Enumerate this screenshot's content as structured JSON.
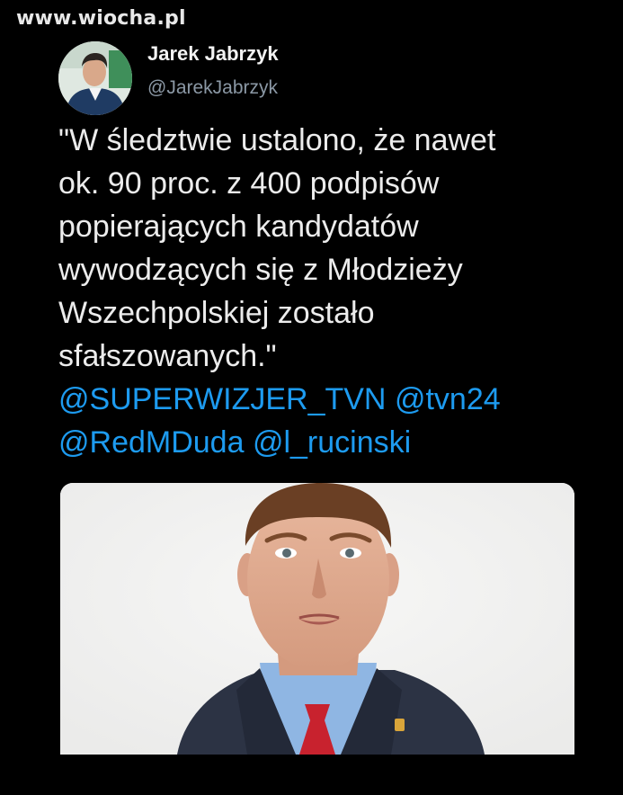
{
  "watermark": {
    "text": "www.wiocha.pl"
  },
  "tweet": {
    "author_name": "Jarek Jabrzyk",
    "author_handle": "@JarekJabrzyk",
    "text": "\"W śledztwie ustalono, że nawet\nok. 90 proc. z 400 podpisów\npopierających kandydatów\nwywodzących się z Młodzieży\nWszechpolskiej zostało\nsfałszowanych.\"",
    "mentions": [
      "@SUPERWIZJER_TVN",
      "@tvn24",
      "@RedMDuda",
      "@l_rucinski"
    ]
  },
  "colors": {
    "background": "#000000",
    "text": "#ececec",
    "handle": "#8b98a5",
    "link": "#1d9bf0"
  },
  "icons": {
    "avatar": "author-avatar-photo",
    "media": "attached-photo-man-in-suit"
  }
}
